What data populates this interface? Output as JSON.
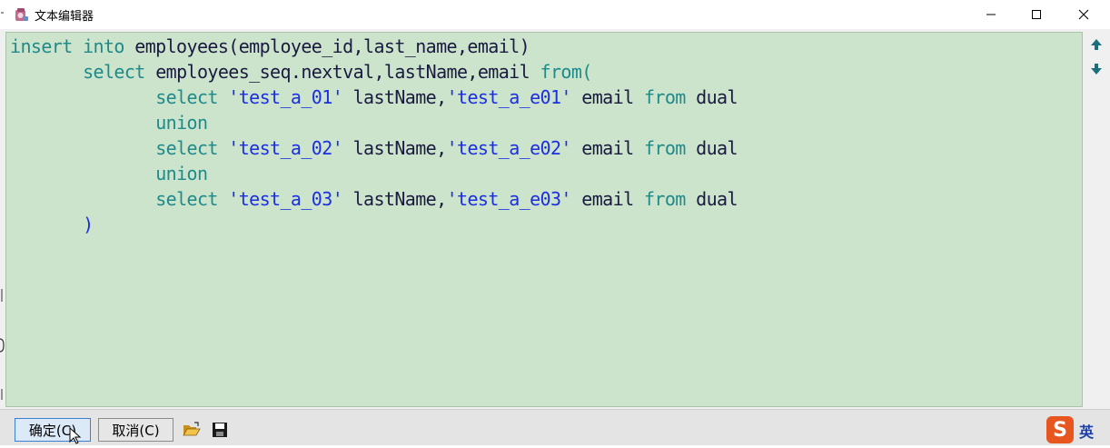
{
  "window": {
    "title": "文本编辑器",
    "icon": "text-editor-app-icon",
    "controls": [
      "minimize-icon",
      "maximize-icon",
      "close-icon"
    ]
  },
  "colors": {
    "editor_background": "#cce4cc",
    "keyword": "#1e8a8a",
    "string": "#1c2ee0",
    "identifier": "#1a1a40"
  },
  "editor": {
    "lines": [
      [
        {
          "t": "insert into ",
          "c": "kw"
        },
        {
          "t": "employees(employee_id,last_name,email)",
          "c": "id"
        }
      ],
      [
        {
          "t": "       ",
          "c": "id"
        },
        {
          "t": "select ",
          "c": "kw"
        },
        {
          "t": "employees_seq.nextval,lastName,email ",
          "c": "id"
        },
        {
          "t": "from(",
          "c": "kw"
        }
      ],
      [
        {
          "t": "              ",
          "c": "id"
        },
        {
          "t": "select ",
          "c": "kw"
        },
        {
          "t": "'test_a_01'",
          "c": "str"
        },
        {
          "t": " lastName,",
          "c": "id"
        },
        {
          "t": "'test_a_e01'",
          "c": "str"
        },
        {
          "t": " email ",
          "c": "id"
        },
        {
          "t": "from ",
          "c": "kw"
        },
        {
          "t": "dual",
          "c": "id"
        }
      ],
      [
        {
          "t": "              ",
          "c": "id"
        },
        {
          "t": "union",
          "c": "kw"
        }
      ],
      [
        {
          "t": "              ",
          "c": "id"
        },
        {
          "t": "select ",
          "c": "kw"
        },
        {
          "t": "'test_a_02'",
          "c": "str"
        },
        {
          "t": " lastName,",
          "c": "id"
        },
        {
          "t": "'test_a_e02'",
          "c": "str"
        },
        {
          "t": " email ",
          "c": "id"
        },
        {
          "t": "from ",
          "c": "kw"
        },
        {
          "t": "dual",
          "c": "id"
        }
      ],
      [
        {
          "t": "              ",
          "c": "id"
        },
        {
          "t": "union",
          "c": "kw"
        }
      ],
      [
        {
          "t": "              ",
          "c": "id"
        },
        {
          "t": "select ",
          "c": "kw"
        },
        {
          "t": "'test_a_03'",
          "c": "str"
        },
        {
          "t": " lastName,",
          "c": "id"
        },
        {
          "t": "'test_a_e03'",
          "c": "str"
        },
        {
          "t": " email ",
          "c": "id"
        },
        {
          "t": "from ",
          "c": "kw"
        },
        {
          "t": "dual",
          "c": "id"
        }
      ],
      [
        {
          "t": "       ",
          "c": "id"
        },
        {
          "t": ")",
          "c": "str"
        }
      ]
    ]
  },
  "scrollbar": {
    "up_icon": "scroll-up-arrow-icon",
    "down_icon": "scroll-down-arrow-icon"
  },
  "toolbar": {
    "ok_label": "确定(C)",
    "cancel_label": "取消(C)",
    "open_icon": "open-folder-icon",
    "save_icon": "save-disk-icon"
  },
  "ime": {
    "logo_letter": "S",
    "language": "英"
  }
}
